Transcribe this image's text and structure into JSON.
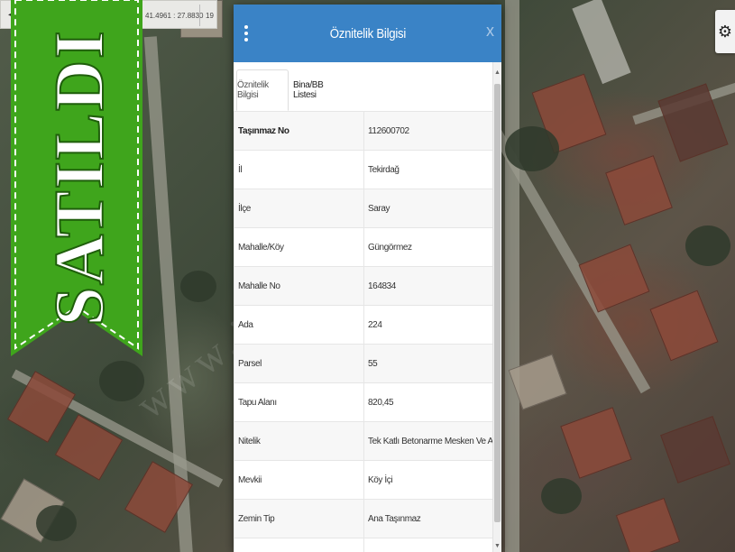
{
  "coordinate_bar": {
    "coordinates": "41.4961 : 27.8830",
    "zoom": "19"
  },
  "sold_banner": {
    "text": "SATILDI",
    "color": "#3fa51c"
  },
  "dialog": {
    "title": "Öznitelik Bilgisi",
    "close_label": "x",
    "header_color": "#3a83c6",
    "tabs": [
      {
        "label": "Öznitelik Bilgisi",
        "active": true
      },
      {
        "label": "Bina/BB Listesi",
        "active": false
      }
    ],
    "rows": [
      {
        "key": "Taşınmaz No",
        "value": "112600702"
      },
      {
        "key": "İl",
        "value": "Tekirdağ"
      },
      {
        "key": "İlçe",
        "value": "Saray"
      },
      {
        "key": "Mahalle/Köy",
        "value": "Güngörmez"
      },
      {
        "key": "Mahalle No",
        "value": "164834"
      },
      {
        "key": "Ada",
        "value": "224"
      },
      {
        "key": "Parsel",
        "value": "55"
      },
      {
        "key": "Tapu Alanı",
        "value": "820,45"
      },
      {
        "key": "Nitelik",
        "value": "Tek Katlı Betonarme Mesken Ve Arsası"
      },
      {
        "key": "Mevkii",
        "value": "Köy İçi"
      },
      {
        "key": "Zemin Tip",
        "value": "Ana Taşınmaz"
      }
    ]
  },
  "icons": {
    "settings": "gear-icon",
    "menu": "kebab-menu-icon"
  }
}
